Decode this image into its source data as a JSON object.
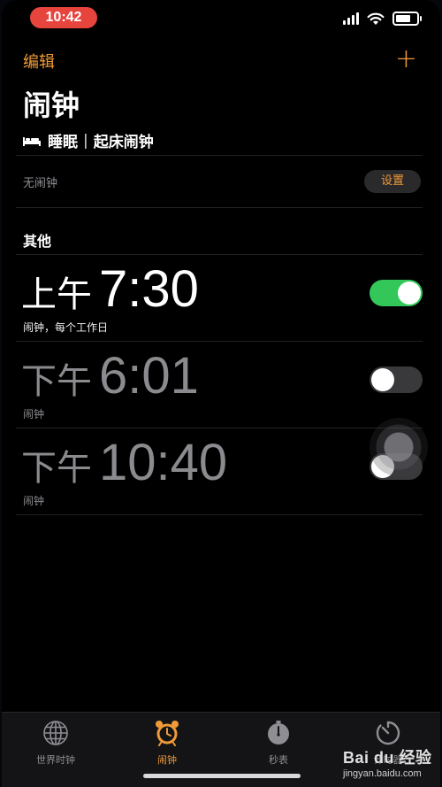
{
  "status_bar": {
    "time": "10:42"
  },
  "nav": {
    "edit_label": "编辑",
    "add_label": "+"
  },
  "title": "闹钟",
  "sleep": {
    "title": "睡眠",
    "separator": "|",
    "subtitle": "起床闹钟",
    "no_alarm": "无闹钟",
    "set_label": "设置"
  },
  "section_title": "其他",
  "alarms": [
    {
      "period": "上午",
      "time": "7:30",
      "label": "闹钟，每个工作日",
      "enabled": true
    },
    {
      "period": "下午",
      "time": "6:01",
      "label": "闹钟",
      "enabled": false
    },
    {
      "period": "下午",
      "time": "10:40",
      "label": "闹钟",
      "enabled": false
    }
  ],
  "tabs": [
    {
      "label": "世界时钟",
      "icon": "globe-icon",
      "active": false
    },
    {
      "label": "闹钟",
      "icon": "alarm-clock-icon",
      "active": true
    },
    {
      "label": "秒表",
      "icon": "stopwatch-icon",
      "active": false
    },
    {
      "label": "计时器",
      "icon": "timer-icon",
      "active": false
    }
  ],
  "watermark": {
    "brand": "Bai du 经验",
    "url": "jingyan.baidu.com"
  },
  "colors": {
    "accent": "#f09a37",
    "toggle_on": "#33c759",
    "time_pill": "#e8443e"
  }
}
